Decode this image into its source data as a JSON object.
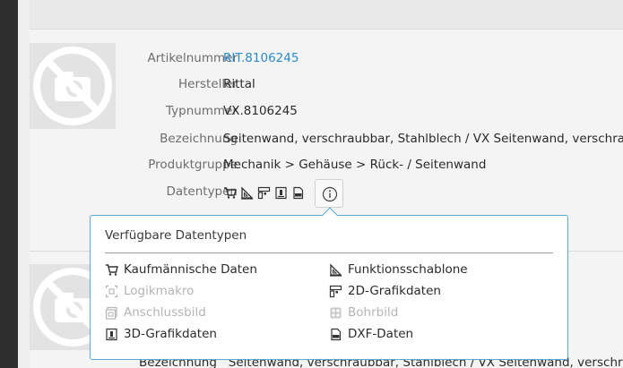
{
  "product": {
    "fields": [
      {
        "label": "Artikelnummer",
        "value": "RIT.8106245"
      },
      {
        "label": "Hersteller",
        "value": "Rittal"
      },
      {
        "label": "Typnummer",
        "value": "VX.8106245"
      },
      {
        "label": "Bezeichnung",
        "value": "Seitenwand, verschraubbar, Stahlblech / VX Seitenwand, verschraubbar"
      },
      {
        "label": "Produktgruppe",
        "value": "Mechanik > Gehäuse > Rück- / Seitenwand"
      },
      {
        "label": "Datentypen",
        "value": ""
      }
    ],
    "datatype_icons": [
      "shopping-cart-icon",
      "set-square-icon",
      "layout-2d-icon",
      "cube-3d-icon",
      "dxf-file-icon"
    ],
    "info_icon": "info-icon",
    "image_icon": "no-image-camera-icon"
  },
  "next_product": {
    "partial_text": "Bezeichnung   Seitenwand, verschraubbar, Stahlblech / VX Seitenwand, verschraubbar"
  },
  "popover": {
    "title": "Verfügbare Datentypen",
    "items": [
      {
        "label": "Kaufmännische Daten",
        "icon": "shopping-cart-icon",
        "available": true
      },
      {
        "label": "Funktionsschablone",
        "icon": "set-square-icon",
        "available": true
      },
      {
        "label": "Logikmakro",
        "icon": "logic-macro-icon",
        "available": false
      },
      {
        "label": "2D-Grafikdaten",
        "icon": "layout-2d-icon",
        "available": true
      },
      {
        "label": "Anschlussbild",
        "icon": "connection-image-icon",
        "available": false
      },
      {
        "label": "Bohrbild",
        "icon": "drill-pattern-icon",
        "available": false
      },
      {
        "label": "3D-Grafikdaten",
        "icon": "cube-3d-icon",
        "available": true
      },
      {
        "label": "DXF-Daten",
        "icon": "dxf-file-icon",
        "available": true
      }
    ]
  },
  "colors": {
    "link": "#2b8ac8",
    "popover_border": "#58a8d6",
    "disabled": "#b4b4b4"
  }
}
